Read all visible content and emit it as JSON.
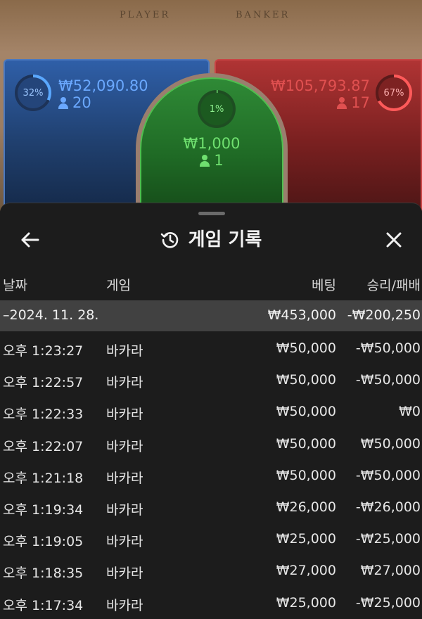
{
  "table": {
    "player_label": "PLAYER",
    "banker_label": "BANKER",
    "player": {
      "percent": "32%",
      "amount": "₩52,090.80",
      "count": "20"
    },
    "tie": {
      "percent": "1%",
      "amount": "₩1,000",
      "count": "1"
    },
    "banker": {
      "percent": "67%",
      "amount": "₩105,793.87",
      "count": "17"
    },
    "colors": {
      "player": "#4a78bf",
      "banker": "#c84444",
      "tie": "#4fbf4f"
    }
  },
  "history": {
    "title": "게임 기록",
    "icons": {
      "back": "arrow-left-icon",
      "title": "history-icon",
      "close": "close-icon"
    },
    "columns": {
      "date": "날짜",
      "game": "게임",
      "bet": "베팅",
      "result": "승리/패배"
    },
    "day": {
      "label": "–2024. 11. 28.",
      "bet": "₩453,000",
      "result": "-₩200,250"
    },
    "rows": [
      {
        "time": "오후 1:23:27",
        "game": "바카라",
        "bet": "₩50,000",
        "result": "-₩50,000"
      },
      {
        "time": "오후 1:22:57",
        "game": "바카라",
        "bet": "₩50,000",
        "result": "-₩50,000"
      },
      {
        "time": "오후 1:22:33",
        "game": "바카라",
        "bet": "₩50,000",
        "result": "₩0"
      },
      {
        "time": "오후 1:22:07",
        "game": "바카라",
        "bet": "₩50,000",
        "result": "₩50,000"
      },
      {
        "time": "오후 1:21:18",
        "game": "바카라",
        "bet": "₩50,000",
        "result": "-₩50,000"
      },
      {
        "time": "오후 1:19:34",
        "game": "바카라",
        "bet": "₩26,000",
        "result": "-₩26,000"
      },
      {
        "time": "오후 1:19:05",
        "game": "바카라",
        "bet": "₩25,000",
        "result": "-₩25,000"
      },
      {
        "time": "오후 1:18:35",
        "game": "바카라",
        "bet": "₩27,000",
        "result": "₩27,000"
      },
      {
        "time": "오후 1:17:34",
        "game": "바카라",
        "bet": "₩25,000",
        "result": "-₩25,000"
      }
    ]
  }
}
